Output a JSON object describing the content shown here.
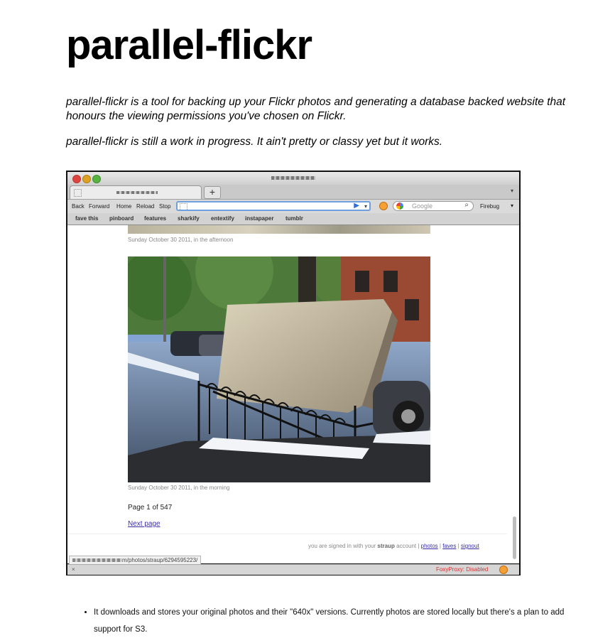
{
  "page": {
    "title": "parallel-flickr",
    "intro_1": "parallel-flickr is a tool for backing up your Flickr photos and generating a database backed website that honours the viewing permissions you've chosen on Flickr.",
    "intro_2": "parallel-flickr is still a work in progress. It ain't pretty or classy yet but it works.",
    "features": [
      "It downloads and stores your original photos and their \"640x\" versions. Currently photos are stored locally but there's a plan to add support for S3."
    ]
  },
  "browser": {
    "new_tab_symbol": "+",
    "nav": {
      "back": "Back",
      "forward": "Forward",
      "home": "Home",
      "reload": "Reload",
      "stop": "Stop"
    },
    "search_placeholder": "Google",
    "firebug_label": "Firebug",
    "bookmarks": [
      "fave this",
      "pinboard",
      "features",
      "sharkify",
      "entextify",
      "instapaper",
      "tumblr"
    ],
    "status_url_suffix": "m/photos/straup/6294595223/",
    "status_close": "×",
    "foxyproxy_status": "FoxyProxy: Disabled"
  },
  "content": {
    "caption_top": "Sunday October 30 2011, in the afternoon",
    "caption_main": "Sunday October 30 2011, in the morning",
    "page_count": "Page 1 of 547",
    "next_page": "Next page",
    "signed_in_prefix": "you are signed in with your",
    "signed_in_user": "straup",
    "signed_in_suffix": "account",
    "links": {
      "photos": "photos",
      "faves": "faves",
      "signout": "signout"
    }
  }
}
